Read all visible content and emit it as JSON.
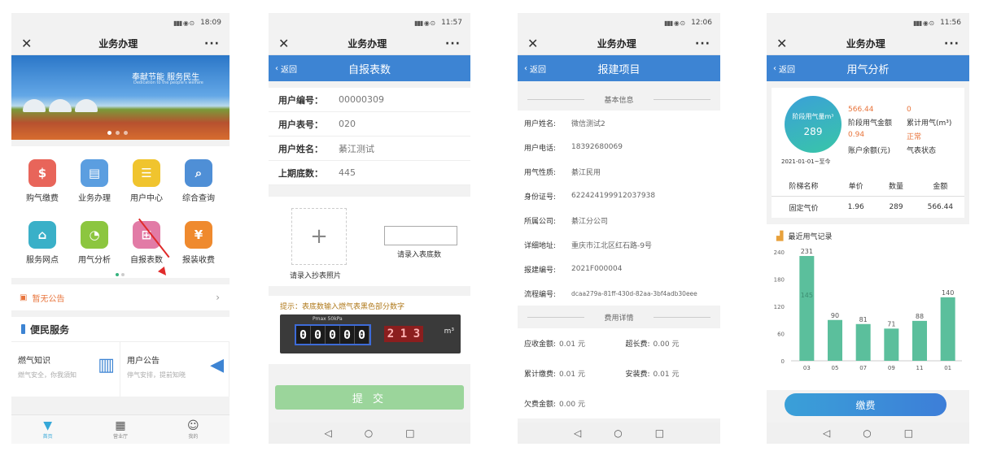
{
  "common": {
    "title": "业务办理",
    "back": "返回",
    "close_icon": "✕",
    "more_icon": "···"
  },
  "p1": {
    "status_time": "18:09",
    "banner_slogan": "奉献节能 服务民生",
    "banner_slogan_en": "Dedication to the people's welfare",
    "menu": [
      {
        "label": "购气缴费",
        "icon": "money-bag-icon",
        "color": "#e8655a"
      },
      {
        "label": "业务办理",
        "icon": "document-icon",
        "color": "#5b9ee0"
      },
      {
        "label": "用户中心",
        "icon": "user-card-icon",
        "color": "#f0c42e"
      },
      {
        "label": "综合查询",
        "icon": "search-doc-icon",
        "color": "#4f8fd6"
      },
      {
        "label": "服务网点",
        "icon": "shop-icon",
        "color": "#3ab0c8"
      },
      {
        "label": "用气分析",
        "icon": "pie-chart-icon",
        "color": "#8cc63f"
      },
      {
        "label": "自报表数",
        "icon": "meter-report-icon",
        "color": "#e27ba6"
      },
      {
        "label": "报装收费",
        "icon": "fee-icon",
        "color": "#ef8a2e"
      }
    ],
    "notice": "暂无公告",
    "section_title": "便民服务",
    "cards": [
      {
        "title": "燃气知识",
        "sub": "燃气安全，你我須知"
      },
      {
        "title": "用户公告",
        "sub": "停气安排，提前知晓"
      }
    ],
    "tabs": [
      {
        "label": "首页"
      },
      {
        "label": "营业厅"
      },
      {
        "label": "我的"
      }
    ]
  },
  "p2": {
    "status_time": "11:57",
    "header": "自报表数",
    "rows": [
      {
        "label": "用户编号：",
        "value": "00000309"
      },
      {
        "label": "用户表号：",
        "value": "020"
      },
      {
        "label": "用户姓名：",
        "value": "綦江测试"
      },
      {
        "label": "上期底数：",
        "value": "445"
      }
    ],
    "photo_label": "请录入抄表照片",
    "input_label": "请录入表底数",
    "tip": "提示：表底数输入燃气表黑色部分数字",
    "meter_caption": "Pmax 50kPa",
    "meter_digits": [
      "0",
      "0",
      "0",
      "0",
      "0"
    ],
    "meter_red": [
      "2",
      "1",
      "3"
    ],
    "meter_unit": "m³",
    "submit": "提 交"
  },
  "p3": {
    "status_time": "12:06",
    "header": "报建项目",
    "basic_title": "基本信息",
    "rows": [
      {
        "label": "用户姓名:",
        "value": "微信测试2"
      },
      {
        "label": "用户电话:",
        "value": "18392680069"
      },
      {
        "label": "用气性质:",
        "value": "綦江民用"
      },
      {
        "label": "身份证号:",
        "value": "622424199912037938"
      },
      {
        "label": "所属公司:",
        "value": "綦江分公司"
      },
      {
        "label": "详细地址:",
        "value": "重庆市江北区红石路-9号"
      },
      {
        "label": "报建编号:",
        "value": "2021F000004"
      },
      {
        "label": "流程编号:",
        "value": "dcaa279a-81ff-430d-82aa-3bf4adb30eee"
      }
    ],
    "fee_title": "费用详情",
    "fees": [
      {
        "label": "应收金额:",
        "value": "0.01 元"
      },
      {
        "label": "超长费:",
        "value": "0.00 元"
      },
      {
        "label": "累计缴费:",
        "value": "0.01 元"
      },
      {
        "label": "安装费:",
        "value": "0.01 元"
      },
      {
        "label": "欠费金额:",
        "value": "0.00 元"
      }
    ]
  },
  "p4": {
    "status_time": "11:56",
    "header": "用气分析",
    "circle_label": "阶段用气量m³",
    "circle_value": "289",
    "period": "2021-01-01~至今",
    "stats": [
      {
        "text": "566.44",
        "style": "orange"
      },
      {
        "text": "0",
        "style": "orange"
      },
      {
        "text": "阶段用气金额",
        "style": "dark"
      },
      {
        "text": "累计用气(m³)",
        "style": "dark"
      },
      {
        "text": "0.94",
        "style": "orange"
      },
      {
        "text": "正常",
        "style": "orange"
      },
      {
        "text": "账户余额(元)",
        "style": "dark"
      },
      {
        "text": "气表状态",
        "style": "dark"
      }
    ],
    "table_head": [
      "阶梯名称",
      "单价",
      "数量",
      "金额"
    ],
    "table_row": [
      "固定气价",
      "1.96",
      "289",
      "566.44"
    ],
    "chart_title": "最近用气记录",
    "pay": "缴费"
  },
  "chart_data": {
    "type": "bar",
    "title": "最近用气记录",
    "categories": [
      "03",
      "05",
      "07",
      "09",
      "11",
      "01"
    ],
    "values": [
      231,
      90,
      81,
      71,
      88,
      140
    ],
    "yticks": [
      0,
      60,
      120,
      180,
      240
    ],
    "ylim": [
      0,
      240
    ],
    "annotation": {
      "category": "03",
      "text": "145"
    },
    "color": "#5bbf9c"
  }
}
